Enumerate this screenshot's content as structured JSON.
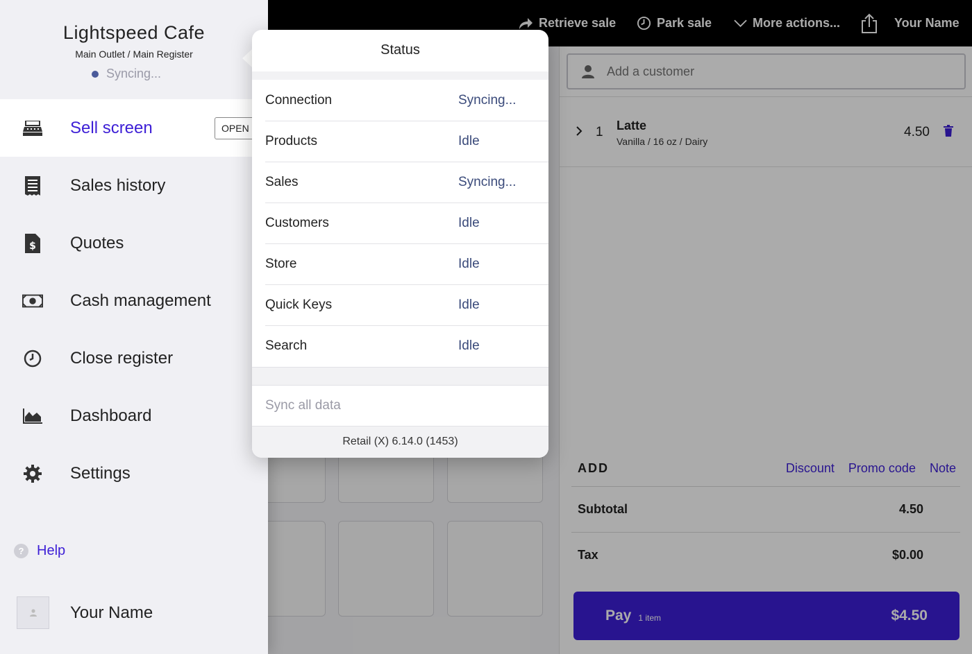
{
  "topbar": {
    "retrieve_sale": "Retrieve sale",
    "park_sale": "Park sale",
    "more_actions": "More actions...",
    "user_name": "Your Name"
  },
  "cart": {
    "customer_placeholder": "Add a customer",
    "line_item": {
      "qty": "1",
      "name": "Latte",
      "variant": "Vanilla / 16 oz / Dairy",
      "price": "4.50"
    },
    "add_label": "ADD",
    "discount": "Discount",
    "promo_code": "Promo code",
    "note": "Note",
    "subtotal_label": "Subtotal",
    "subtotal_value": "4.50",
    "tax_label": "Tax",
    "tax_value": "$0.00",
    "pay_label": "Pay",
    "pay_count": "1 item",
    "pay_amount": "$4.50"
  },
  "sidebar": {
    "store_name": "Lightspeed Cafe",
    "outlet": "Main Outlet / Main Register",
    "sync_status": "Syncing...",
    "open_badge": "OPEN",
    "items": [
      {
        "label": "Sell screen",
        "icon": "register-icon"
      },
      {
        "label": "Sales history",
        "icon": "receipt-icon"
      },
      {
        "label": "Quotes",
        "icon": "quote-document-icon"
      },
      {
        "label": "Cash management",
        "icon": "cash-icon"
      },
      {
        "label": "Close register",
        "icon": "clock-icon"
      },
      {
        "label": "Dashboard",
        "icon": "chart-icon"
      },
      {
        "label": "Settings",
        "icon": "gear-icon"
      }
    ],
    "help": "Help",
    "user_name": "Your Name"
  },
  "status_popover": {
    "title": "Status",
    "rows": [
      {
        "label": "Connection",
        "value": "Syncing..."
      },
      {
        "label": "Products",
        "value": "Idle"
      },
      {
        "label": "Sales",
        "value": "Syncing..."
      },
      {
        "label": "Customers",
        "value": "Idle"
      },
      {
        "label": "Store",
        "value": "Idle"
      },
      {
        "label": "Quick Keys",
        "value": "Idle"
      },
      {
        "label": "Search",
        "value": "Idle"
      }
    ],
    "sync_all": "Sync all data",
    "version": "Retail (X) 6.14.0 (1453)"
  },
  "colors": {
    "accent": "#3d1fd6",
    "topbar": "#000000",
    "status_value": "#3a4a7a"
  }
}
